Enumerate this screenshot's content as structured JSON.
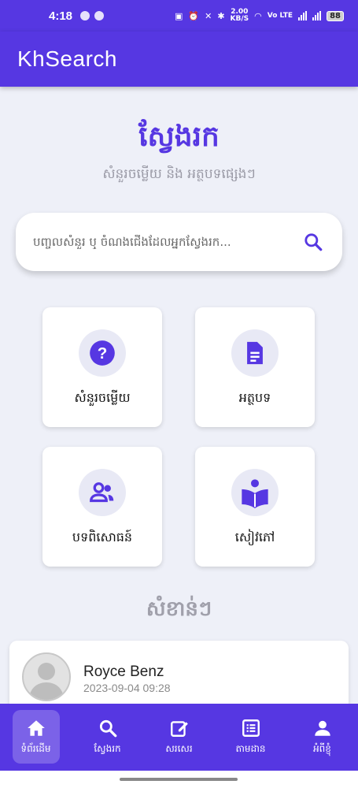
{
  "status_bar": {
    "time": "4:18",
    "speed_top": "2.00",
    "speed_unit": "KB/S",
    "network": "Vo LTE",
    "battery": "88"
  },
  "app_bar": {
    "title": "KhSearch"
  },
  "hero": {
    "title": "ស្វែងរក",
    "subtitle": "សំនួរចម្លើយ និង អត្ថបទផ្សេងៗ"
  },
  "search": {
    "placeholder": "បញ្ចូលសំនួរ ឬ ចំណងជើងដែលអ្នកស្វែងរក...",
    "value": ""
  },
  "categories": [
    {
      "label": "សំនួរចម្លើយ",
      "icon": "help-circle-icon"
    },
    {
      "label": "អត្ថបទ",
      "icon": "document-icon"
    },
    {
      "label": "បទពិសោធន៍",
      "icon": "people-icon"
    },
    {
      "label": "សៀវភៅ",
      "icon": "reading-book-icon"
    }
  ],
  "section": {
    "title": "សំខាន់ៗ"
  },
  "post": {
    "author": "Royce Benz",
    "time": "2023-09-04 09:28"
  },
  "bottom_nav": [
    {
      "label": "ទំព័រដើម",
      "icon": "home-icon",
      "active": true
    },
    {
      "label": "ស្វែងរក",
      "icon": "search-icon"
    },
    {
      "label": "សរសេរ",
      "icon": "edit-icon"
    },
    {
      "label": "តាមដាន",
      "icon": "list-icon"
    },
    {
      "label": "អំពីខ្ញុំ",
      "icon": "person-icon"
    }
  ],
  "colors": {
    "primary": "#5637e2",
    "background": "#eef0f8",
    "icon_circle": "#e8e9f5"
  }
}
